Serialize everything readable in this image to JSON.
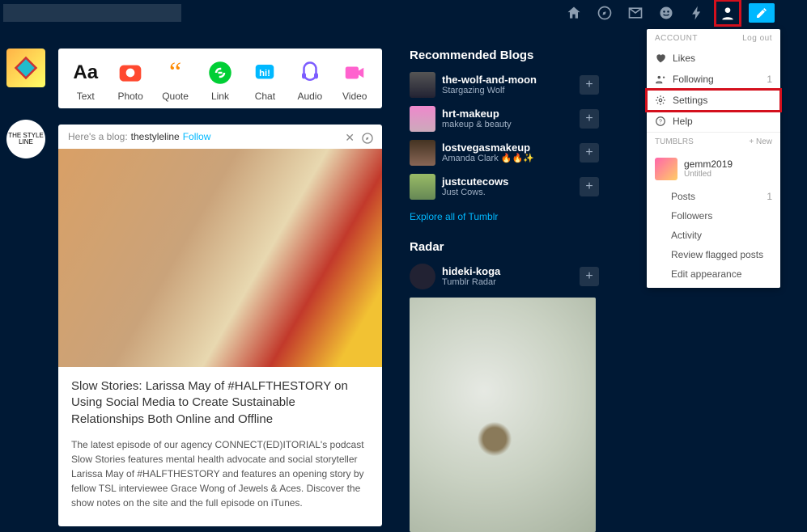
{
  "nav": {
    "home": "Home",
    "explore": "Explore",
    "inbox": "Inbox",
    "messaging": "Messaging",
    "activity": "Activity",
    "account": "Account",
    "compose": "Compose"
  },
  "post_types": {
    "text": "Text",
    "photo": "Photo",
    "quote": "Quote",
    "link": "Link",
    "chat": "Chat",
    "audio": "Audio",
    "video": "Video"
  },
  "feed": {
    "intro": "Here's a blog:",
    "blog": "thestyleline",
    "follow": "Follow",
    "title": "Slow Stories: Larissa May of #HALFTHESTORY on Using Social Media to Create Sustainable Relationships Both Online and Offline",
    "desc": "The latest episode of our agency CONNECT(ED)ITORIAL's podcast Slow Stories features mental health advocate and social storyteller Larissa May of #HALFTHESTORY and features an opening story by fellow TSL interviewee Grace Wong of Jewels & Aces. Discover the show notes on the site and the full episode on iTunes."
  },
  "recommended": {
    "title": "Recommended Blogs",
    "explore": "Explore all of Tumblr",
    "blogs": [
      {
        "name": "the-wolf-and-moon",
        "sub": "Stargazing Wolf"
      },
      {
        "name": "hrt-makeup",
        "sub": "makeup & beauty"
      },
      {
        "name": "lostvegasmakeup",
        "sub": "Amanda Clark 🔥🔥✨"
      },
      {
        "name": "justcutecows",
        "sub": "Just Cows."
      }
    ]
  },
  "radar": {
    "title": "Radar",
    "name": "hideki-koga",
    "sub": "Tumblr Radar"
  },
  "dropdown": {
    "account": "ACCOUNT",
    "logout": "Log out",
    "likes": "Likes",
    "following": "Following",
    "following_count": "1",
    "settings": "Settings",
    "help": "Help",
    "tumblrs": "TUMBLRS",
    "new": "+ New",
    "blog": {
      "name": "gemm2019",
      "sub": "Untitled"
    },
    "posts": "Posts",
    "posts_count": "1",
    "followers": "Followers",
    "activity": "Activity",
    "review": "Review flagged posts",
    "edit": "Edit appearance"
  },
  "leftrail": {
    "styleline": "THE STYLE LINE"
  }
}
